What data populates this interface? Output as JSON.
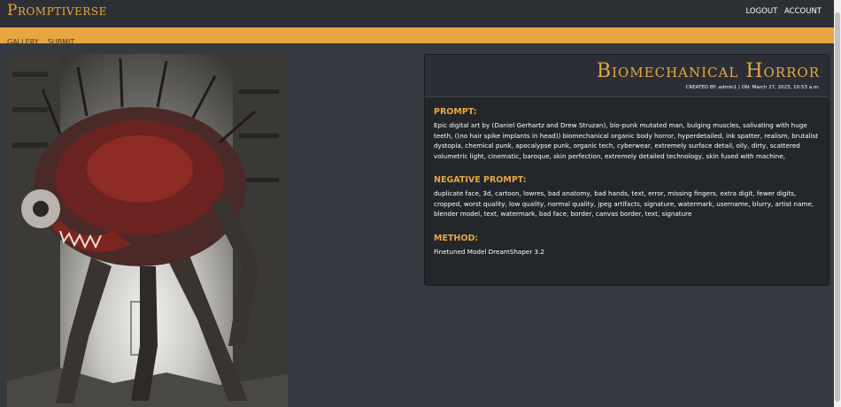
{
  "brand": "Promptiverse",
  "topnav": {
    "logout": "LOGOUT",
    "account": "ACCOUNT"
  },
  "subnav": {
    "gallery": "GALLERY",
    "submit": "SUBMIT"
  },
  "item": {
    "title": "Biomechanical Horror",
    "created": "CREATED BY: admin1 | ON: March 27, 2023, 10:53 a.m.",
    "prompt_heading": "PROMPT:",
    "prompt": "Epic digital art by (Daniel Gerhartz and Drew Struzan), bio-punk mutated man, bulging muscles, salivating with huge teeth, ((no hair spike implants in head)) biomechanical organic body horror, hyperdetailed, ink spatter, realism, brutalist dystopia, chemical punk, apocalypse punk, organic tech, cyberwear, extremely surface detail, oily, dirty, scattered volumetric light, cinematic, baroque, skin perfection, extremely detailed technology, skin fused with machine,",
    "negative_heading": "NEGATIVE PROMPT:",
    "negative": "duplicate face, 3d, cartoon, lowres, bad anatomy, bad hands, text, error, missing fingers, extra digit, fewer digits, cropped, worst quality, low quality, normal quality, jpeg artifacts, signature, watermark, username, blurry, artist name, blender model, text, watermark, bad face, border, canvas border, text, signature",
    "method_heading": "METHOD:",
    "method": "Finetuned Model DreamShaper 3.2"
  },
  "image_alt": "biomechanical-creature-artwork"
}
